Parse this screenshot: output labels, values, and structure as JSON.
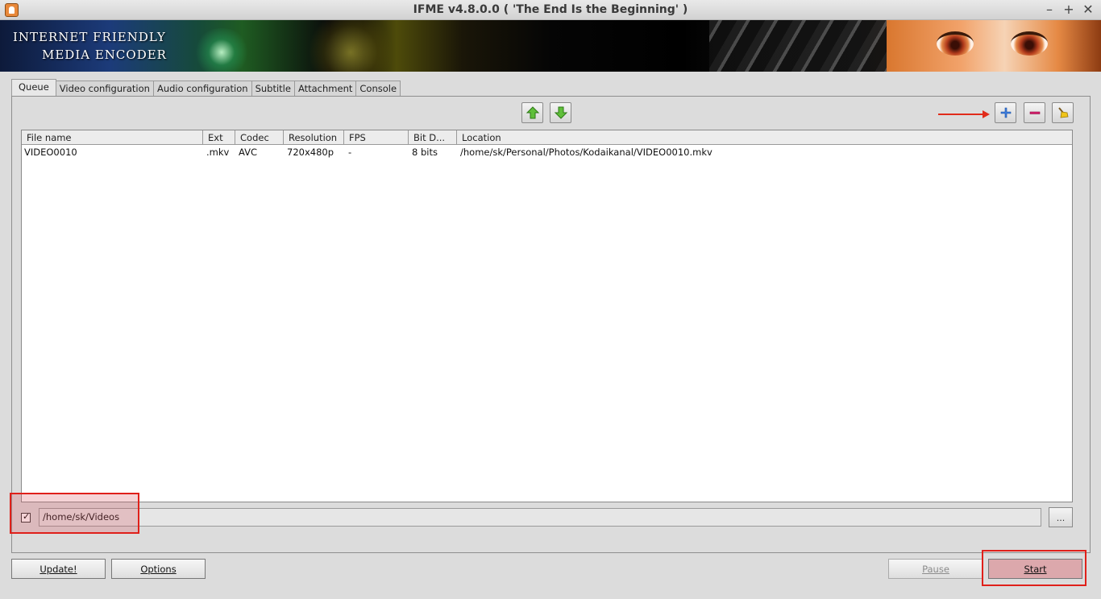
{
  "window": {
    "title": "IFME v4.8.0.0 ( 'The End Is the Beginning' )",
    "controls": [
      "–",
      "+",
      "✕"
    ]
  },
  "banner": {
    "line1": "INTERNET FRIENDLY",
    "line2": "MEDIA ENCODER"
  },
  "tabs": [
    {
      "label": "Queue",
      "active": true
    },
    {
      "label": "Video configuration"
    },
    {
      "label": "Audio configuration"
    },
    {
      "label": "Subtitle"
    },
    {
      "label": "Attachment"
    },
    {
      "label": "Console"
    }
  ],
  "toolbar": {
    "icons": [
      "move-up-icon",
      "move-down-icon",
      "add-file-icon",
      "remove-file-icon",
      "clear-queue-icon"
    ]
  },
  "queue": {
    "columns": [
      "File name",
      "Ext",
      "Codec",
      "Resolution",
      "FPS",
      "Bit D...",
      "Location"
    ],
    "rows": [
      {
        "file_name": "VIDEO0010",
        "ext": ".mkv",
        "codec": "AVC",
        "resolution": "720x480p",
        "fps": "-",
        "bit_depth": "8 bits",
        "location": "/home/sk/Personal/Photos/Kodaikanal/VIDEO0010.mkv"
      }
    ]
  },
  "output": {
    "checked": true,
    "check_mark": "✓",
    "path": "/home/sk/Videos",
    "browse_label": "..."
  },
  "buttons": {
    "update": "Update!",
    "options": "Options",
    "pause": "Pause",
    "start": "Start"
  },
  "colors": {
    "highlight": "#e0201a",
    "arrow": "#e12b1a"
  }
}
